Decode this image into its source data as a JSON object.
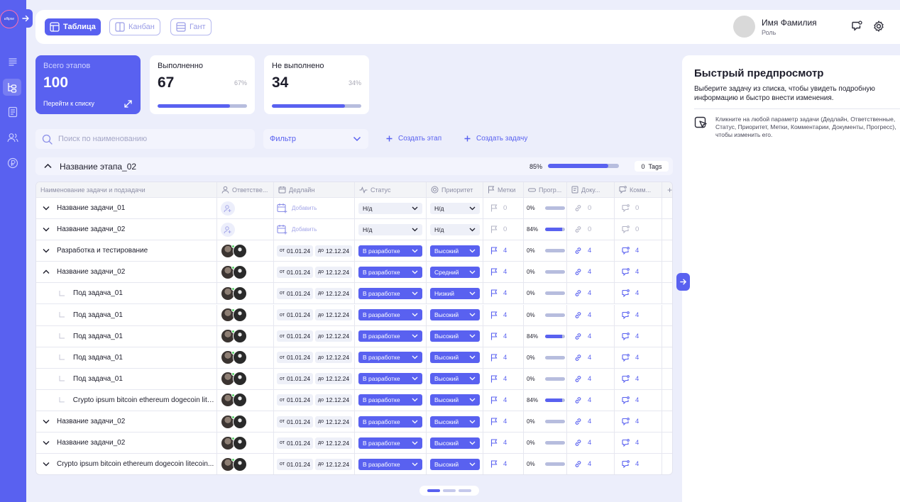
{
  "brand": {
    "logo_text": "ellipse"
  },
  "header": {
    "views": [
      {
        "label": "Таблица",
        "active": true
      },
      {
        "label": "Канбан",
        "active": false
      },
      {
        "label": "Гант",
        "active": false
      }
    ],
    "user": {
      "name": "Имя Фамилия",
      "role": "Роль"
    }
  },
  "stats": {
    "total": {
      "label": "Всего этапов",
      "value": "100",
      "link": "Перейти к списку"
    },
    "done": {
      "label": "Выполненно",
      "value": "67",
      "percent": "67%",
      "fraction": 0.67
    },
    "not_done": {
      "label": "Не выполнено",
      "value": "34",
      "percent": "34%",
      "fraction": 0.34
    }
  },
  "toolbar": {
    "search_placeholder": "Поиск по наименованию",
    "filter_label": "Фильтр",
    "create_stage": "Создать этап",
    "create_task": "Создать задачу"
  },
  "stage": {
    "title": "Название этапа_02",
    "progress_label": "85%",
    "progress": 0.85,
    "tags_count": "0",
    "tags_label": "Tags"
  },
  "table": {
    "columns": [
      "Наименование задачи и подзадачи",
      "Ответстве...",
      "Дедлайн",
      "Статус",
      "Приоритет",
      "Метки",
      "Прогр...",
      "Доку...",
      "Комм..."
    ],
    "add_column_label": "+",
    "date_from_prefix": "от",
    "date_to_prefix": "до",
    "add_deadline_label": "Добавить",
    "rows": [
      {
        "name": "Название задачи_01",
        "sub": false,
        "expanded": false,
        "assigned": false,
        "from": "",
        "to": "",
        "status": "Н/д",
        "priority": "Н/д",
        "tags": "0",
        "progress_label": "0%",
        "progress": 0,
        "docs": "0",
        "comments": "0",
        "filled": false
      },
      {
        "name": "Название задачи_02",
        "sub": false,
        "expanded": false,
        "assigned": false,
        "from": "",
        "to": "",
        "status": "Н/д",
        "priority": "Н/д",
        "tags": "0",
        "progress_label": "84%",
        "progress": 0.84,
        "docs": "0",
        "comments": "0",
        "filled": false
      },
      {
        "name": "Разработка и тестирование",
        "sub": false,
        "expanded": false,
        "assigned": true,
        "from": "01.01.24",
        "to": "12.12.24",
        "status": "В разработке",
        "priority": "Высокий",
        "tags": "4",
        "progress_label": "0%",
        "progress": 0,
        "docs": "4",
        "comments": "4",
        "filled": true
      },
      {
        "name": "Название задачи_02",
        "sub": false,
        "expanded": true,
        "assigned": true,
        "from": "01.01.24",
        "to": "12.12.24",
        "status": "В разработке",
        "priority": "Средний",
        "tags": "4",
        "progress_label": "0%",
        "progress": 0,
        "docs": "4",
        "comments": "4",
        "filled": true
      },
      {
        "name": "Под задача_01",
        "sub": true,
        "expanded": false,
        "assigned": true,
        "from": "01.01.24",
        "to": "12.12.24",
        "status": "В разработке",
        "priority": "Низкий",
        "tags": "4",
        "progress_label": "0%",
        "progress": 0,
        "docs": "4",
        "comments": "4",
        "filled": true
      },
      {
        "name": "Под задача_01",
        "sub": true,
        "expanded": false,
        "assigned": true,
        "from": "01.01.24",
        "to": "12.12.24",
        "status": "В разработке",
        "priority": "Высокий",
        "tags": "4",
        "progress_label": "0%",
        "progress": 0,
        "docs": "4",
        "comments": "4",
        "filled": true
      },
      {
        "name": "Под задача_01",
        "sub": true,
        "expanded": false,
        "assigned": true,
        "from": "01.01.24",
        "to": "12.12.24",
        "status": "В разработке",
        "priority": "Высокий",
        "tags": "4",
        "progress_label": "84%",
        "progress": 0.84,
        "docs": "4",
        "comments": "4",
        "filled": true
      },
      {
        "name": "Под задача_01",
        "sub": true,
        "expanded": false,
        "assigned": true,
        "from": "01.01.24",
        "to": "12.12.24",
        "status": "В разработке",
        "priority": "Высокий",
        "tags": "4",
        "progress_label": "0%",
        "progress": 0,
        "docs": "4",
        "comments": "4",
        "filled": true
      },
      {
        "name": "Под задача_01",
        "sub": true,
        "expanded": false,
        "assigned": true,
        "from": "01.01.24",
        "to": "12.12.24",
        "status": "В разработке",
        "priority": "Высокий",
        "tags": "4",
        "progress_label": "0%",
        "progress": 0,
        "docs": "4",
        "comments": "4",
        "filled": true
      },
      {
        "name": "Crypto ipsum bitcoin ethereum dogecoin litec...",
        "sub": true,
        "expanded": false,
        "assigned": true,
        "from": "01.01.24",
        "to": "12.12.24",
        "status": "В разработке",
        "priority": "Высокий",
        "tags": "4",
        "progress_label": "84%",
        "progress": 0.84,
        "docs": "4",
        "comments": "4",
        "filled": true
      },
      {
        "name": "Название задачи_02",
        "sub": false,
        "expanded": false,
        "assigned": true,
        "from": "01.01.24",
        "to": "12.12.24",
        "status": "В разработке",
        "priority": "Высокий",
        "tags": "4",
        "progress_label": "0%",
        "progress": 0,
        "docs": "4",
        "comments": "4",
        "filled": true
      },
      {
        "name": "Название задачи_02",
        "sub": false,
        "expanded": false,
        "assigned": true,
        "from": "01.01.24",
        "to": "12.12.24",
        "status": "В разработке",
        "priority": "Высокий",
        "tags": "4",
        "progress_label": "0%",
        "progress": 0,
        "docs": "4",
        "comments": "4",
        "filled": true
      },
      {
        "name": "Crypto ipsum bitcoin ethereum dogecoin litecoin...",
        "sub": false,
        "expanded": false,
        "assigned": true,
        "from": "01.01.24",
        "to": "12.12.24",
        "status": "В разработке",
        "priority": "Высокий",
        "tags": "4",
        "progress_label": "0%",
        "progress": 0,
        "docs": "4",
        "comments": "4",
        "filled": true
      }
    ]
  },
  "preview": {
    "title": "Быстрый предпросмотр",
    "subtitle": "Выберите задачу из списка, чтобы увидеть подробную информацию и быстро внести изменения.",
    "hint": "Кликните на любой параметр задачи (Дедлайн, Ответственные, Статус, Приоритет, Метки, Комментарии, Документы, Прогресс), чтобы изменить его."
  },
  "colors": {
    "accent": "#5961f0",
    "background": "#eceefb",
    "track": "#b7bdde"
  }
}
